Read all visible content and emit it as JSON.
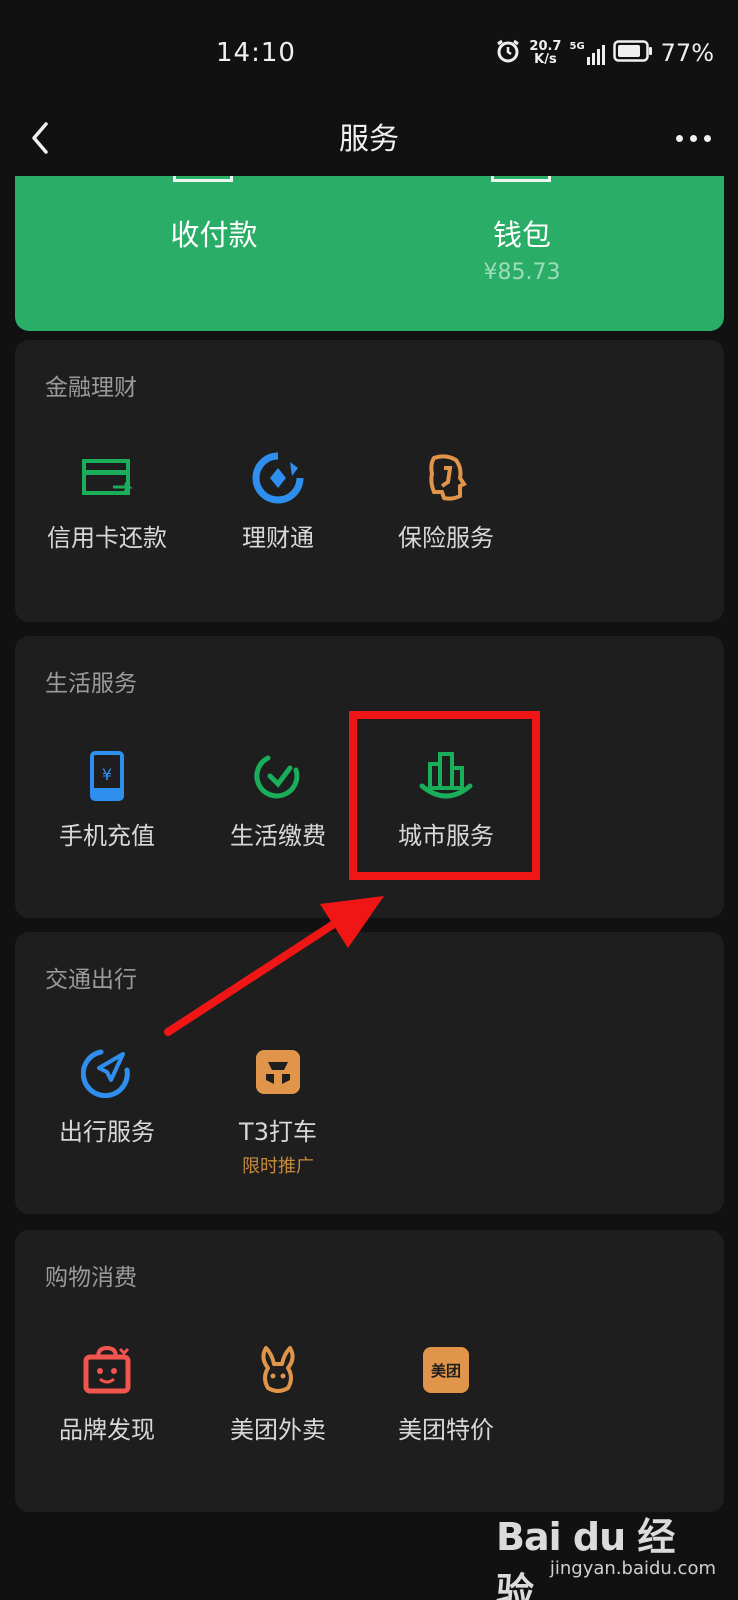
{
  "status_bar": {
    "time": "14:10",
    "net_speed_value": "20.7",
    "net_speed_unit": "K/s",
    "network_type": "5G",
    "battery": "77%",
    "icons": [
      "alarm-icon",
      "signal-icon",
      "battery-icon"
    ]
  },
  "nav": {
    "title": "服务",
    "back_icon": "chevron-left-icon",
    "more_icon": "more-dots-icon"
  },
  "top_card": {
    "background": "#2aae67",
    "items": [
      {
        "label": "收付款",
        "sub": ""
      },
      {
        "label": "钱包",
        "sub": "¥85.73"
      }
    ]
  },
  "sections": [
    {
      "title": "金融理财",
      "items": [
        {
          "label": "信用卡还款",
          "icon": "credit-card-icon",
          "color": "#1aad5a"
        },
        {
          "label": "理财通",
          "icon": "wealth-icon",
          "color": "#2f8fef"
        },
        {
          "label": "保险服务",
          "icon": "insurance-icon",
          "color": "#e0954a"
        }
      ]
    },
    {
      "title": "生活服务",
      "items": [
        {
          "label": "手机充值",
          "icon": "phone-recharge-icon",
          "color": "#2f8fef"
        },
        {
          "label": "生活缴费",
          "icon": "bill-payment-icon",
          "color": "#1aad5a"
        },
        {
          "label": "城市服务",
          "icon": "city-service-icon",
          "color": "#1aad5a"
        }
      ]
    },
    {
      "title": "交通出行",
      "items": [
        {
          "label": "出行服务",
          "icon": "travel-icon",
          "color": "#2f8fef"
        },
        {
          "label": "T3打车",
          "icon": "t3-taxi-icon",
          "color": "#e0954a",
          "tag": "限时推广"
        }
      ]
    },
    {
      "title": "购物消费",
      "items": [
        {
          "label": "品牌发现",
          "icon": "brand-bag-icon",
          "color": "#f2544e"
        },
        {
          "label": "美团外卖",
          "icon": "meituan-waimai-icon",
          "color": "#e0954a"
        },
        {
          "label": "美团特价",
          "icon": "meituan-icon",
          "color": "#e0954a",
          "icon_text": "美团"
        }
      ]
    }
  ],
  "annotation": {
    "highlight_color": "#f01616"
  },
  "watermark": {
    "logo": "Bai du 经验",
    "url": "jingyan.baidu.com"
  }
}
